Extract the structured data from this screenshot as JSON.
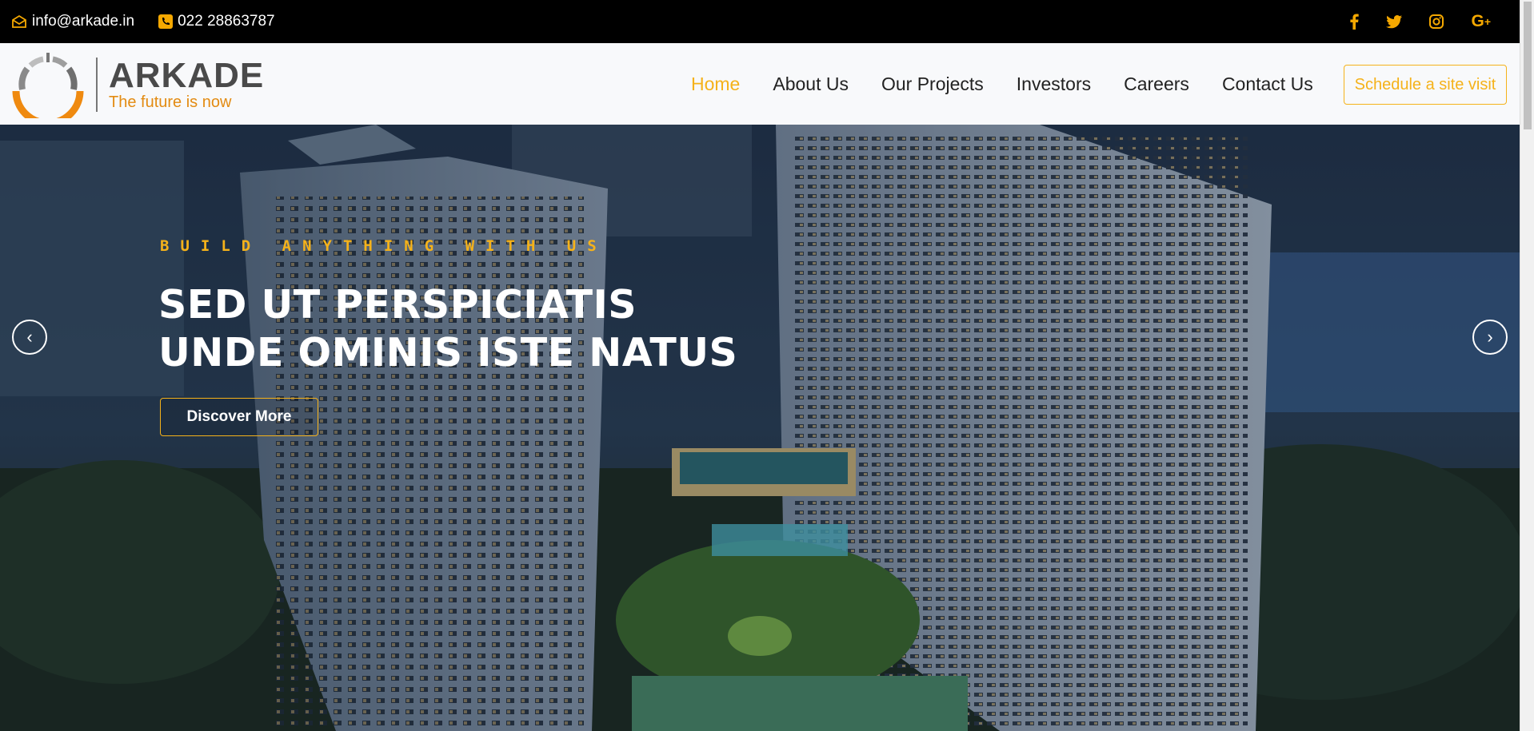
{
  "topbar": {
    "email": "info@arkade.in",
    "phone": "022 28863787",
    "icons": [
      "envelope-icon",
      "phone-icon"
    ],
    "socials": [
      {
        "name": "facebook-icon",
        "glyph": "f"
      },
      {
        "name": "twitter-icon",
        "glyph": "t"
      },
      {
        "name": "instagram-icon",
        "glyph": "ig"
      },
      {
        "name": "google-plus-icon",
        "glyph": "G+"
      }
    ],
    "accent": "#f5a800"
  },
  "header": {
    "logo_name": "ARKADE",
    "logo_tagline": "The future is now",
    "nav": [
      "Home",
      "About Us",
      "Our Projects",
      "Investors",
      "Careers",
      "Contact Us"
    ],
    "active_nav": "Home",
    "cta": "Schedule a site visit",
    "accent": "#f5b21a"
  },
  "hero": {
    "eyebrow": "BUILD ANYTHING WITH US",
    "headline_line1": "SED UT PERSPICIATIS",
    "headline_line2": "UNDE OMINIS ISTE NATUS",
    "button": "Discover More",
    "prev_glyph": "‹",
    "next_glyph": "›"
  }
}
